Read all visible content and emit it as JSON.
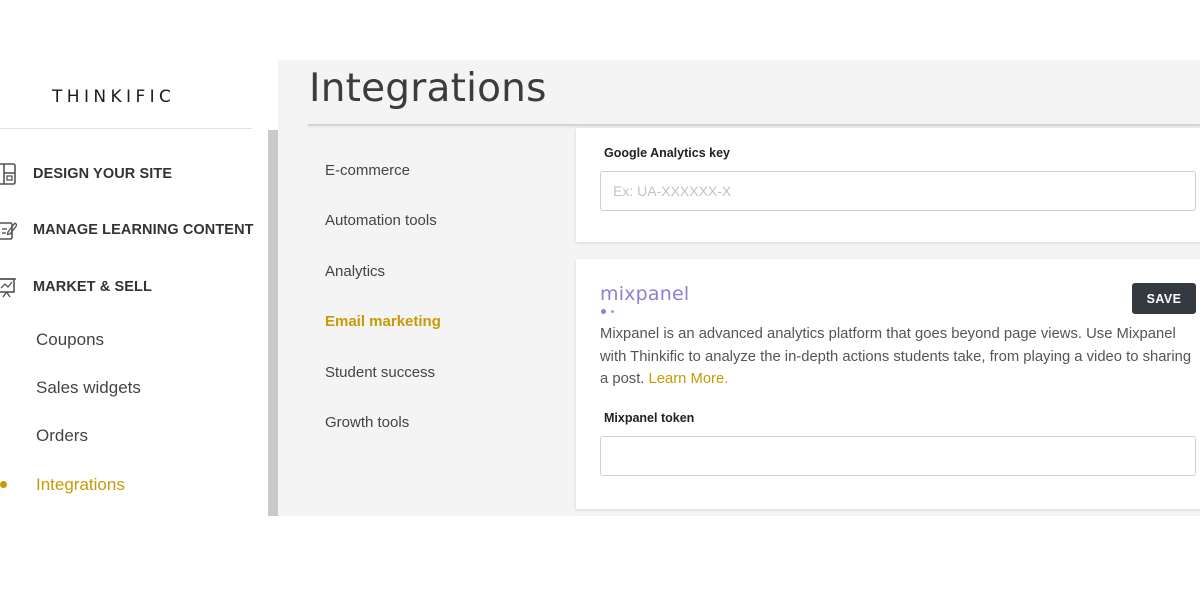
{
  "sidebar": {
    "logo": "THINKIFIC",
    "nav": [
      {
        "label": "DESIGN YOUR SITE",
        "icon": "layout-icon"
      },
      {
        "label": "MANAGE LEARNING CONTENT",
        "icon": "edit-icon"
      },
      {
        "label": "MARKET & SELL",
        "icon": "presentation-chart-icon"
      }
    ],
    "subnav": [
      {
        "label": "Coupons",
        "active": false
      },
      {
        "label": "Sales widgets",
        "active": false
      },
      {
        "label": "Orders",
        "active": false
      },
      {
        "label": "Integrations",
        "active": true
      }
    ]
  },
  "main": {
    "title": "Integrations",
    "sections": [
      {
        "label": "E-commerce",
        "active": false
      },
      {
        "label": "Automation tools",
        "active": false
      },
      {
        "label": "Analytics",
        "active": false
      },
      {
        "label": "Email marketing",
        "active": true
      },
      {
        "label": "Student success",
        "active": false
      },
      {
        "label": "Growth tools",
        "active": false
      }
    ],
    "google_analytics": {
      "label": "Google Analytics key",
      "placeholder": "Ex: UA-XXXXXX-X",
      "value": ""
    },
    "mixpanel": {
      "logo_text": "mixpanel",
      "save_label": "SAVE",
      "description": "Mixpanel is an advanced analytics platform that goes beyond page views. Use Mixpanel with Thinkific to analyze the in-depth actions students take, from playing a video to sharing a post.",
      "learn_more": "Learn More.",
      "token_label": "Mixpanel token",
      "token_value": ""
    }
  },
  "colors": {
    "accent": "#c79a06",
    "button_dark": "#343a40",
    "mixpanel_purple": "#8d7fd4"
  }
}
